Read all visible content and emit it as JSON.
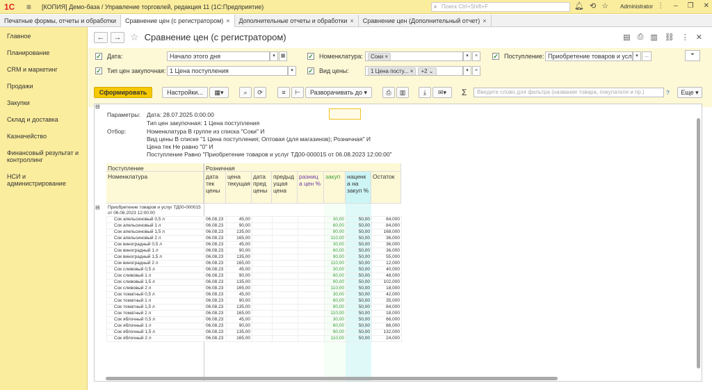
{
  "app": {
    "logo": "1С",
    "title": "[КОПИЯ] Демо-база / Управление торговлей, редакция 11  (1С:Предприятие)",
    "search_placeholder": "Поиск Ctrl+Shift+F",
    "user": "Administrator"
  },
  "tabs": [
    {
      "label": "Печатные формы, отчеты и обработки"
    },
    {
      "label": "Сравнение цен (с регистратором)"
    },
    {
      "label": "Дополнительные отчеты и обработки"
    },
    {
      "label": "Сравнение цен (Дополнительный отчет)"
    }
  ],
  "sidebar": [
    "Главное",
    "Планирование",
    "CRM и маркетинг",
    "Продажи",
    "Закупки",
    "Склад и доставка",
    "Казначейство",
    "Финансовый результат и контроллинг",
    "НСИ и администрирование"
  ],
  "form": {
    "title": "Сравнение цен (с регистратором)"
  },
  "params": {
    "date_label": "Дата:",
    "date_value": "Начало этого дня",
    "nom_label": "Номенклатура:",
    "nom_tag": "Соки",
    "receipt_label": "Поступление:",
    "receipt_value": "Приобретение товаров и услу",
    "pricetype_label": "Тип цен закупочная:",
    "pricetype_value": "1 Цена поступления",
    "kind_label": "Вид цены:",
    "kind_tag": "1 Цена посту...",
    "kind_more": "+2"
  },
  "toolbar": {
    "generate": "Сформировать",
    "settings": "Настройки...",
    "expand": "Разворачивать до",
    "filter_placeholder": "Введите слово для фильтра (название товара, покупателя и пр.)",
    "help": "?",
    "more": "Еще"
  },
  "report": {
    "params_label": "Параметры:",
    "param1": "Дата: 28.07.2025 0:00:00",
    "param2": "Тип цен закупочная: 1 Цена поступления",
    "filter_label": "Отбор:",
    "filter1": "Номенклатура В группе из списка \"Соки\" И",
    "filter2": "Вид цены В списке \"1 Цена поступления; Оптовая (для магазинов); Розничная\" И",
    "filter3": "Цена тек Не равно \"0\" И",
    "filter4": "Поступление Равно \"Приобретение товаров и услуг ТД00-000015 от 06.08.2023 12:00:00\"",
    "h_receipt": "Поступление",
    "h_nom": "Номенклатура",
    "h_retail": "Розничная",
    "cols": [
      "дата тек цены",
      "цена текущая",
      "дата пред цены",
      "предыд ущая цена",
      "разниц а цен %",
      "закуп",
      "наценк а на закуп %",
      "Остаток"
    ],
    "group": "Приобретение товаров и услуг ТД00-000015 от 06.08.2023 12:00:00",
    "rows": [
      [
        "Сок апельсиновый 0,5 л",
        "06.08.23",
        "45,00",
        "",
        "",
        "30,00",
        "50,00",
        "84,000"
      ],
      [
        "Сок апельсиновый 1 л",
        "06.08.23",
        "90,00",
        "",
        "",
        "60,00",
        "50,00",
        "84,000"
      ],
      [
        "Сок апельсиновый 1,5 л",
        "06.08.23",
        "135,00",
        "",
        "",
        "90,00",
        "50,00",
        "168,000"
      ],
      [
        "Сок апельсиновый 2 л",
        "06.08.23",
        "165,00",
        "",
        "",
        "110,00",
        "50,00",
        "36,000"
      ],
      [
        "Сок виноградный 0,5 л",
        "06.08.23",
        "45,00",
        "",
        "",
        "30,00",
        "50,00",
        "36,000"
      ],
      [
        "Сок виноградный 1 л",
        "06.08.23",
        "90,00",
        "",
        "",
        "60,00",
        "50,00",
        "36,000"
      ],
      [
        "Сок виноградный 1,5 л",
        "06.08.23",
        "135,00",
        "",
        "",
        "90,00",
        "50,00",
        "55,000"
      ],
      [
        "Сок виноградный 2 л",
        "06.08.23",
        "165,00",
        "",
        "",
        "110,00",
        "50,00",
        "12,000"
      ],
      [
        "Сок сливовый 0,5 л",
        "06.08.23",
        "45,00",
        "",
        "",
        "30,00",
        "50,00",
        "40,000"
      ],
      [
        "Сок сливовый 1 л",
        "06.08.23",
        "90,00",
        "",
        "",
        "60,00",
        "50,00",
        "48,000"
      ],
      [
        "Сок сливовый 1,5 л",
        "06.08.23",
        "135,00",
        "",
        "",
        "90,00",
        "50,00",
        "102,000"
      ],
      [
        "Сок сливовый 2 л",
        "06.08.23",
        "165,00",
        "",
        "",
        "110,00",
        "50,00",
        "18,000"
      ],
      [
        "Сок томатный 0,5 л",
        "06.08.23",
        "45,00",
        "",
        "",
        "30,00",
        "50,00",
        "42,000"
      ],
      [
        "Сок томатный 1 л",
        "06.08.23",
        "90,00",
        "",
        "",
        "60,00",
        "50,00",
        "35,000"
      ],
      [
        "Сок томатный 1,5 л",
        "06.08.23",
        "135,00",
        "",
        "",
        "90,00",
        "50,00",
        "84,000"
      ],
      [
        "Сок томатный 2 л",
        "06.08.23",
        "165,00",
        "",
        "",
        "110,00",
        "50,00",
        "18,000"
      ],
      [
        "Сок яблочный 0,5 л",
        "06.08.23",
        "45,00",
        "",
        "",
        "30,00",
        "50,00",
        "66,000"
      ],
      [
        "Сок яблочный 1 л",
        "06.08.23",
        "90,00",
        "",
        "",
        "60,00",
        "50,00",
        "66,000"
      ],
      [
        "Сок яблочный 1,5 л",
        "06.08.23",
        "135,00",
        "",
        "",
        "90,00",
        "50,00",
        "132,000"
      ],
      [
        "Сок яблочный 2 л",
        "06.08.23",
        "165,00",
        "",
        "",
        "110,00",
        "50,00",
        "24,000"
      ]
    ]
  }
}
